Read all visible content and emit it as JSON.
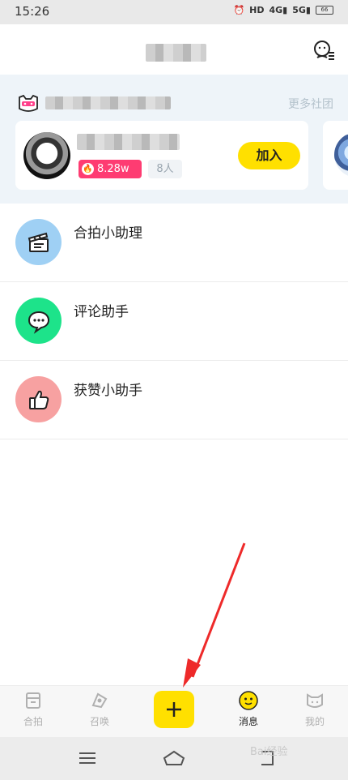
{
  "status_bar": {
    "time": "15:26",
    "battery": "66"
  },
  "community": {
    "more_label": "更多社团"
  },
  "card": {
    "hot_count": "8.28w",
    "member_count": "8人",
    "join_label": "加入"
  },
  "messages": [
    {
      "label": "合拍小助理",
      "color": "#9fd0f4",
      "icon": "clapperboard-icon"
    },
    {
      "label": "评论助手",
      "color": "#1de38a",
      "icon": "chat-bubble-icon"
    },
    {
      "label": "获赞小助手",
      "color": "#f7a1a1",
      "icon": "thumbs-up-icon"
    }
  ],
  "tabs": [
    {
      "label": "合拍",
      "icon": "box-icon",
      "active": false
    },
    {
      "label": "召唤",
      "icon": "summon-icon",
      "active": false
    },
    {
      "label": "消息",
      "icon": "emoji-face-icon",
      "active": true
    },
    {
      "label": "我的",
      "icon": "cat-face-icon",
      "active": false
    }
  ],
  "watermark": "Bai经验",
  "colors": {
    "accent_yellow": "#ffe000",
    "hot_pink": "#fe3c72",
    "arrow_red": "#ee2a2a"
  }
}
